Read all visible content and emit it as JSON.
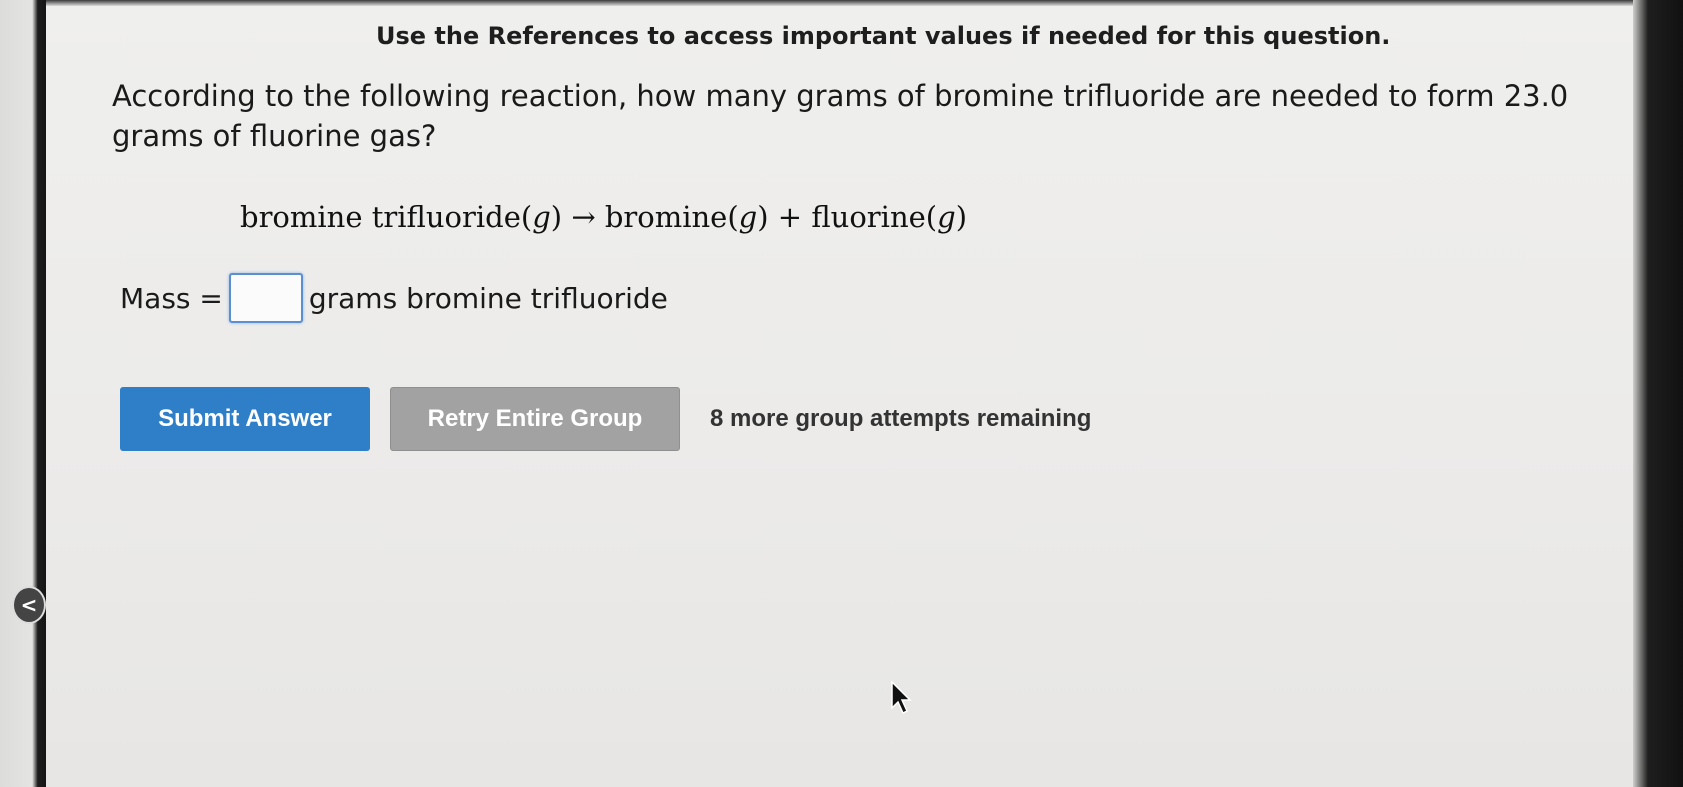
{
  "header": {
    "reference_note": "Use the References to access important values if needed for this question."
  },
  "question": {
    "text": "According to the following reaction, how many grams of bromine trifluoride are needed to form 23.0 grams of fluorine gas?"
  },
  "equation": {
    "reactant": "bromine trifluoride",
    "product_1": "bromine",
    "product_2": "fluorine",
    "phase": "g",
    "arrow": "→",
    "plus": "+"
  },
  "answer": {
    "label": "Mass =",
    "input_value": "",
    "unit": "grams bromine trifluoride"
  },
  "buttons": {
    "submit_label": "Submit Answer",
    "retry_label": "Retry Entire Group"
  },
  "attempts_text": "8 more group attempts remaining",
  "navigation": {
    "prev_label": "<"
  },
  "colors": {
    "submit_button": "#2f7fc8",
    "retry_button": "#a2a2a2",
    "input_border": "#5c8fd0"
  }
}
